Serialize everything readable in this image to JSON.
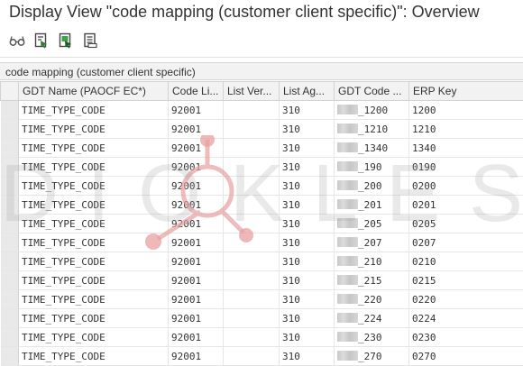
{
  "window": {
    "title": "Display View \"code mapping (customer client specific)\": Overview"
  },
  "toolbar": {
    "buttons": [
      {
        "icon": "glasses-icon"
      },
      {
        "icon": "document-arrow-icon"
      },
      {
        "icon": "document-green-arrow-icon"
      },
      {
        "icon": "document-list-icon"
      }
    ]
  },
  "section": {
    "title": "code mapping (customer client specific)"
  },
  "table": {
    "headers": [
      "GDT Name (PAOCF EC*)",
      "Code Li...",
      "List Ver...",
      "List Ag...",
      "GDT Code ...",
      "ERP Key"
    ],
    "rows": [
      {
        "gdt_name": "TIME_TYPE_CODE",
        "code_list": "92001",
        "list_version": "",
        "list_agency": "310",
        "gdt_code": "_1200",
        "erp_key": "1200"
      },
      {
        "gdt_name": "TIME_TYPE_CODE",
        "code_list": "92001",
        "list_version": "",
        "list_agency": "310",
        "gdt_code": "_1210",
        "erp_key": "1210"
      },
      {
        "gdt_name": "TIME_TYPE_CODE",
        "code_list": "92001",
        "list_version": "",
        "list_agency": "310",
        "gdt_code": "_1340",
        "erp_key": "1340"
      },
      {
        "gdt_name": "TIME_TYPE_CODE",
        "code_list": "92001",
        "list_version": "",
        "list_agency": "310",
        "gdt_code": "_190",
        "erp_key": "0190"
      },
      {
        "gdt_name": "TIME_TYPE_CODE",
        "code_list": "92001",
        "list_version": "",
        "list_agency": "310",
        "gdt_code": "_200",
        "erp_key": "0200"
      },
      {
        "gdt_name": "TIME_TYPE_CODE",
        "code_list": "92001",
        "list_version": "",
        "list_agency": "310",
        "gdt_code": "_201",
        "erp_key": "0201"
      },
      {
        "gdt_name": "TIME_TYPE_CODE",
        "code_list": "92001",
        "list_version": "",
        "list_agency": "310",
        "gdt_code": "_205",
        "erp_key": "0205"
      },
      {
        "gdt_name": "TIME_TYPE_CODE",
        "code_list": "92001",
        "list_version": "",
        "list_agency": "310",
        "gdt_code": "_207",
        "erp_key": "0207"
      },
      {
        "gdt_name": "TIME_TYPE_CODE",
        "code_list": "92001",
        "list_version": "",
        "list_agency": "310",
        "gdt_code": "_210",
        "erp_key": "0210"
      },
      {
        "gdt_name": "TIME_TYPE_CODE",
        "code_list": "92001",
        "list_version": "",
        "list_agency": "310",
        "gdt_code": "_215",
        "erp_key": "0215"
      },
      {
        "gdt_name": "TIME_TYPE_CODE",
        "code_list": "92001",
        "list_version": "",
        "list_agency": "310",
        "gdt_code": "_220",
        "erp_key": "0220"
      },
      {
        "gdt_name": "TIME_TYPE_CODE",
        "code_list": "92001",
        "list_version": "",
        "list_agency": "310",
        "gdt_code": "_224",
        "erp_key": "0224"
      },
      {
        "gdt_name": "TIME_TYPE_CODE",
        "code_list": "92001",
        "list_version": "",
        "list_agency": "310",
        "gdt_code": "_230",
        "erp_key": "0230"
      },
      {
        "gdt_name": "TIME_TYPE_CODE",
        "code_list": "92001",
        "list_version": "",
        "list_agency": "310",
        "gdt_code": "_270",
        "erp_key": "0270"
      }
    ]
  },
  "watermark": {
    "text": "DIOKLES",
    "color": "#e8a0a0"
  }
}
